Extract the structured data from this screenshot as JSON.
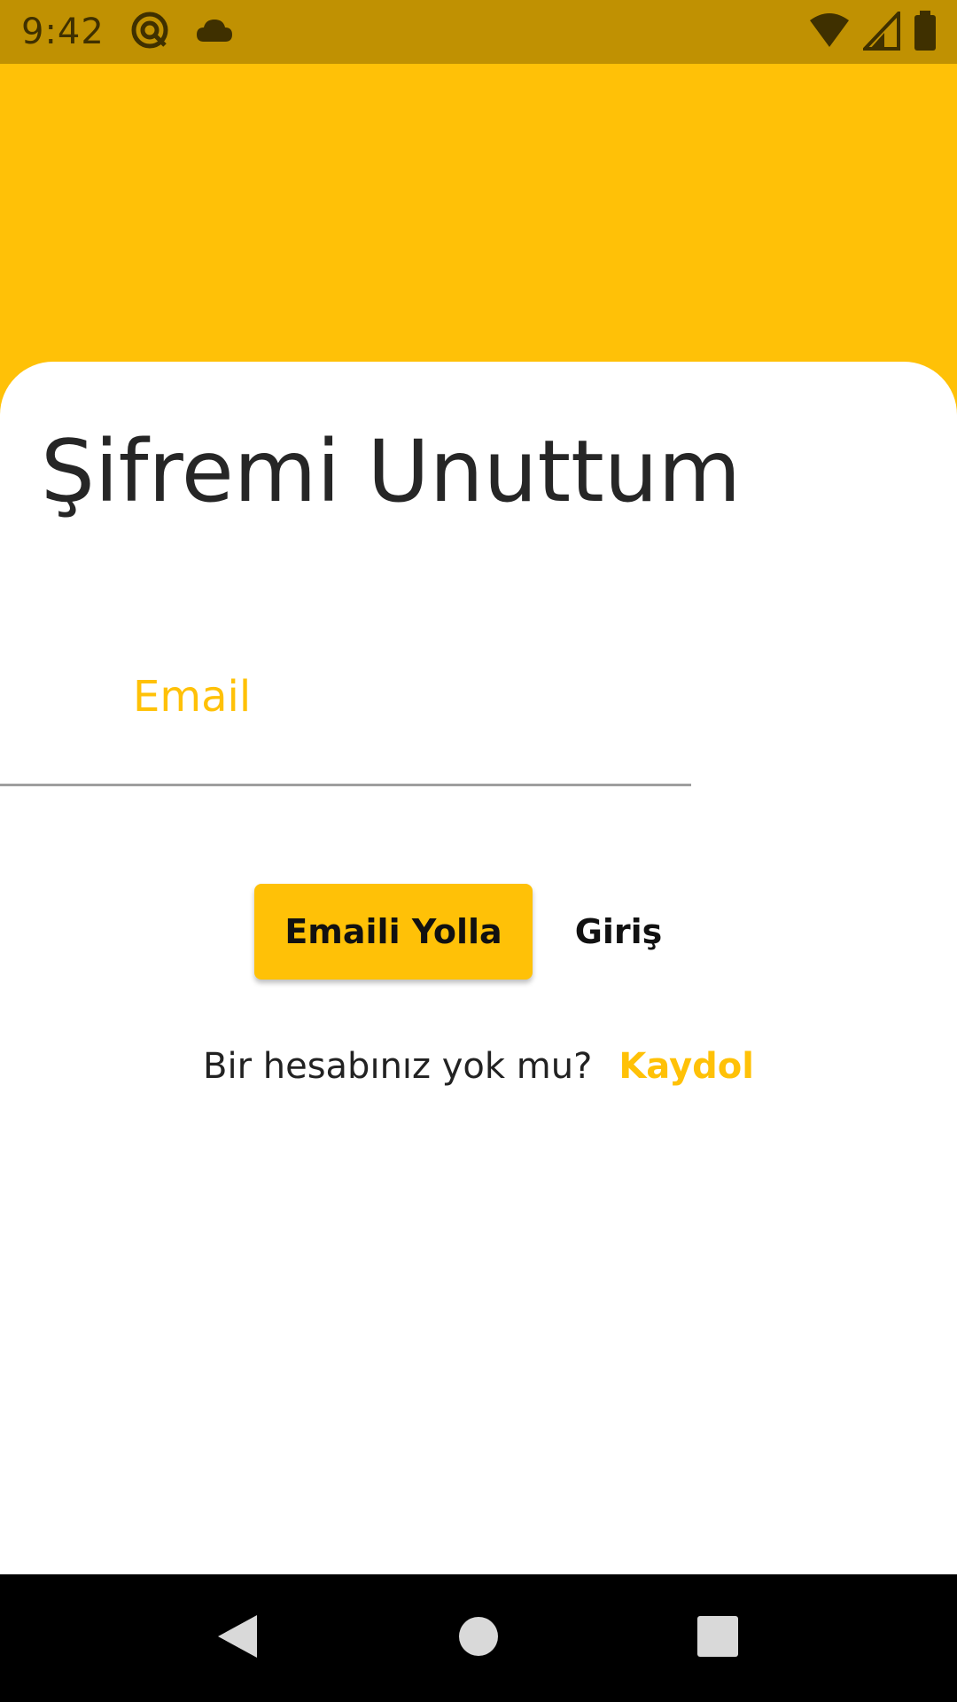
{
  "status_bar": {
    "time": "9:42",
    "icons_left": [
      "at-sign-icon",
      "cloud-icon"
    ],
    "icons_right": [
      "wifi-icon",
      "signal-icon",
      "battery-icon"
    ]
  },
  "colors": {
    "accent": "#FFC107",
    "status_bar": "#C09102",
    "text_dark": "#262626",
    "underline": "#9e9e9e",
    "nav_bar": "#000000"
  },
  "page": {
    "title": "Şifremi Unuttum"
  },
  "form": {
    "email_label": "Email",
    "email_value": ""
  },
  "actions": {
    "send_label": "Emaili Yolla",
    "login_label": "Giriş"
  },
  "signup": {
    "prompt": "Bir hesabınız yok mu?",
    "link": "Kaydol"
  },
  "nav": {
    "icons": [
      "back-icon",
      "home-icon",
      "recents-icon"
    ]
  }
}
